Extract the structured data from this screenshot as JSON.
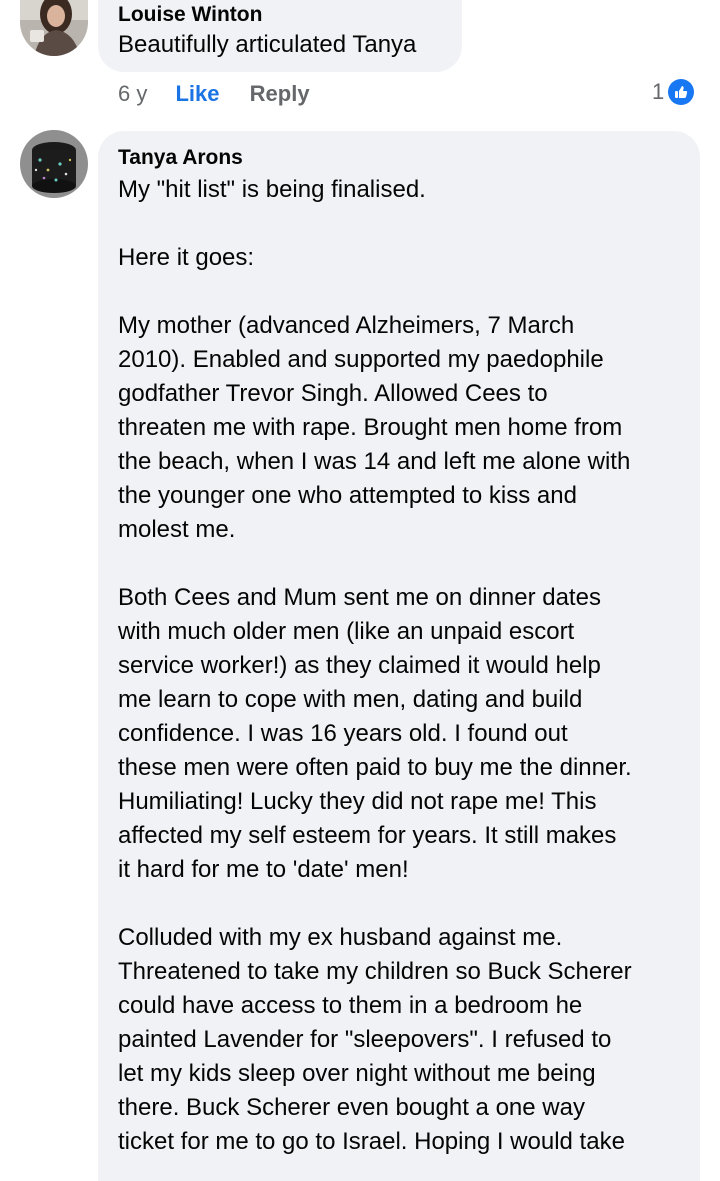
{
  "comments": [
    {
      "author": "Louise Winton",
      "text": "Beautifully articulated Tanya",
      "time": "6 y",
      "like_label": "Like",
      "reply_label": "Reply",
      "reaction_count": "1",
      "reaction_icon": "thumbs-up-icon",
      "reaction_color": "#1877f2"
    },
    {
      "author": "Tanya Arons",
      "paragraphs": [
        "My \"hit list\" is being finalised.",
        "Here it goes:",
        "My mother (advanced Alzheimers, 7 March\n2010).  Enabled and supported my paedophile\ngodfather Trevor Singh.  Allowed Cees to\nthreaten me with rape.  Brought men home from\nthe beach, when I was 14 and left me alone with\nthe younger one who attempted to kiss and\nmolest  me.",
        "Both Cees and Mum sent me on dinner dates\nwith much older men (like an unpaid escort\nservice worker!) as they claimed it would help\nme learn to cope with men, dating and build\nconfidence.  I was 16 years old.  I found out\nthese men were often paid to buy me the dinner.\nHumiliating! Lucky they did not rape me!  This\naffected my self esteem for years.  It still makes\nit hard for me to 'date' men!",
        "Colluded with my ex husband against me.\nThreatened to take my children so Buck Scherer\ncould have access to them in a bedroom he\npainted Lavender for \"sleepovers\".  I refused to\nlet my kids sleep over night without me being\nthere. Buck Scherer even bought a one way\nticket for me to go to Israel. Hoping I would take"
      ]
    }
  ]
}
